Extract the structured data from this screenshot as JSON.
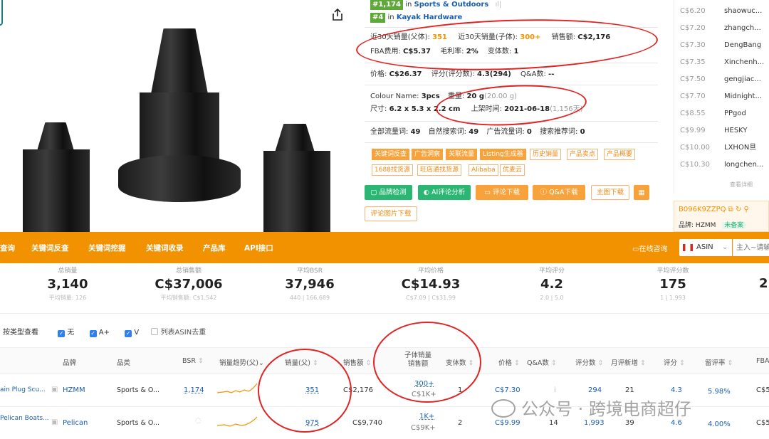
{
  "ranks": {
    "rank1": "#1,174",
    "in1": " in ",
    "cat1": "Sports & Outdoors",
    "rank2": "#4",
    "in2": " in ",
    "cat2": "Kayak Hardware"
  },
  "metrics": {
    "sales30_label": "近30天销量(父体):",
    "sales30": "351",
    "child30_label": "近30天销量(子体):",
    "child30": "300+",
    "revenue_label": "销售额:",
    "revenue": "C$2,176",
    "fba_label": "FBA费用:",
    "fba": "C$5.37",
    "margin_label": "毛利率:",
    "margin": "2%",
    "variants_label": "变体数:",
    "variants": "1",
    "price_label": "价格:",
    "price": "C$26.37",
    "reviews_label": "评分(评分数):",
    "reviews": "4.3(294)",
    "qa_label": "Q&A数:",
    "qa": "--",
    "colour_label": "Colour Name:",
    "colour": "3pcs",
    "weight_label": "重量:",
    "weight": "20 g",
    "weight_extra": "(20.00 g)",
    "size_label": "尺寸:",
    "size": "6.2 x 5.3 x 2.2 cm",
    "listed_label": "上架时间:",
    "listed": "2021-06-18",
    "listed_extra": "(1,156天)",
    "traffic_label": "全部流量词:",
    "traffic": "49",
    "organic_label": "自然搜索词:",
    "organic": "49",
    "ad_label": "广告流量词:",
    "ad": "0",
    "rec_label": "搜索推荐词:",
    "rec": "0"
  },
  "tags": [
    "关键词反查",
    "广告洞察",
    "关联流量",
    "Listing生成器",
    "历史销量",
    "产品卖点",
    "产品概要",
    "1688找货源",
    "旺店通找货源",
    "Alibaba",
    "优麦云"
  ],
  "buttons": {
    "brand_check": "品牌检测",
    "ai_review": "AI评论分析",
    "review_download": "评论下载",
    "qa_download": "Q&A下载",
    "main_image_download": "主图下载",
    "review_image_download": "评论图片下载"
  },
  "sellers": [
    {
      "price": "C$6.20",
      "name": "shaowuc..."
    },
    {
      "price": "C$7.20",
      "name": "zhangch..."
    },
    {
      "price": "C$7.30",
      "name": "DengBang"
    },
    {
      "price": "C$7.35",
      "name": "Xinchenh..."
    },
    {
      "price": "C$7.50",
      "name": "gengjiac..."
    },
    {
      "price": "C$7.70",
      "name": "Midnight..."
    },
    {
      "price": "C$8.55",
      "name": "PPgod"
    },
    {
      "price": "C$9.99",
      "name": "HESKY"
    },
    {
      "price": "C$10.00",
      "name": "LXHON旦"
    },
    {
      "price": "C$10.30",
      "name": "longchen..."
    }
  ],
  "seller_more": "查看详细",
  "asin_box": {
    "asin": "B096K9ZZPQ",
    "brand_label": "品牌:",
    "brand": "HZMM",
    "status": "未备案"
  },
  "nav": {
    "items": [
      "查询",
      "关键词反查",
      "关键词挖掘",
      "关键词收录",
      "产品库",
      "API接口"
    ],
    "online": "在线咨询",
    "market": "ASIN",
    "search_placeholder": "主入~请输"
  },
  "stats": [
    {
      "label": "总销量",
      "value": "3,140",
      "sub": "平均销量: 126"
    },
    {
      "label": "总销售额",
      "value": "C$37,006",
      "sub": "平均销售额: C$1,542"
    },
    {
      "label": "平均BSR",
      "value": "37,946",
      "sub": "440 | 166,689"
    },
    {
      "label": "平均价格",
      "value": "C$14.93",
      "sub": "C$7.09 | C$31.99"
    },
    {
      "label": "平均评分",
      "value": "4.2",
      "sub": "2.0 | 5.0"
    },
    {
      "label": "平均评分数",
      "value": "175",
      "sub": "1 | 1,993"
    },
    {
      "label": "",
      "value": "2",
      "sub": ""
    }
  ],
  "filters": {
    "label": "按类型查看",
    "opt1": "无",
    "opt2": "A+",
    "opt3": "V",
    "dedupe": "列表ASIN去重"
  },
  "table": {
    "headers": {
      "brand": "品牌",
      "category": "品类",
      "bsr": "BSR",
      "trend": "销量趋势(父)",
      "sales": "销量(父)",
      "revenue": "销售额",
      "child1": "子体销量",
      "child2": "销售额",
      "variants": "变体数",
      "price": "价格",
      "qa": "Q&A数",
      "reviews": "评分数",
      "new_reviews": "月评新增",
      "rating": "评分",
      "retention": "留评率",
      "fba": "FBA"
    },
    "rows": [
      {
        "title": "ain Plug Scu...",
        "brand": "HZMM",
        "category": "Sports & O...",
        "bsr": "1,174",
        "sales": "351",
        "revenue": "C$2,176",
        "child_sales": "300+",
        "child_rev": "C$1K+",
        "variants": "1",
        "price": "C$7.30",
        "qa": "i",
        "reviews": "294",
        "new_reviews": "21",
        "rating": "4.3",
        "retention": "5.98%",
        "fba": "C$5."
      },
      {
        "title": "Pelican Boats...",
        "brand": "Pelican",
        "category": "Sports & O...",
        "bsr": "",
        "sales": "975",
        "revenue": "C$9,740",
        "child_sales": "1K+",
        "child_rev": "C$9K+",
        "variants": "2",
        "price": "C$9.99",
        "qa": "14",
        "reviews": "1,993",
        "new_reviews": "39",
        "rating": "4.6",
        "retention": "4.00%",
        "fba": "C$5."
      }
    ]
  },
  "watermark": "公众号 · 跨境电商超仔",
  "colors": {
    "accent": "#f39200",
    "link": "#1a5fb4",
    "rank_green": "#5fa83a",
    "annotation_red": "#e02424"
  }
}
